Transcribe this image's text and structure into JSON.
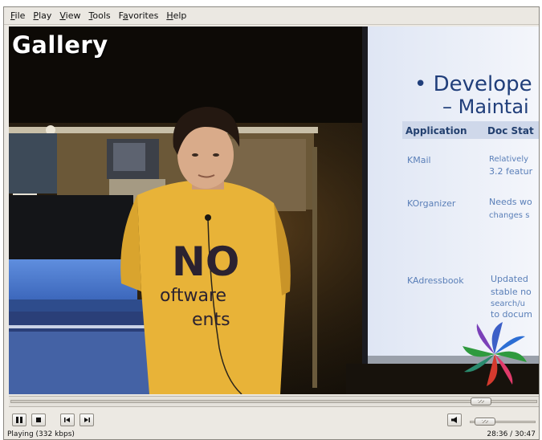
{
  "menu": [
    {
      "label": "File",
      "key": "F",
      "rest": "ile"
    },
    {
      "label": "Play",
      "key": "P",
      "rest": "lay"
    },
    {
      "label": "View",
      "key": "V",
      "rest": "iew"
    },
    {
      "label": "Tools",
      "key": "T",
      "rest": "ools"
    },
    {
      "label": "Favorites",
      "key": "a",
      "pre": "F",
      "rest": "vorites"
    },
    {
      "label": "Help",
      "key": "H",
      "rest": "elp"
    }
  ],
  "video": {
    "overlay_label": "Gallery",
    "shirt_text_line1": "NO",
    "shirt_text_line2": "oftware",
    "shirt_text_line3": "ents",
    "slide": {
      "title_line1": "• Develope",
      "title_line2": "– Maintai",
      "col_app": "Application",
      "col_doc": "Doc Stat",
      "rows": [
        {
          "app": "KMail",
          "doc1": "Relatively",
          "doc2": "3.2 featur"
        },
        {
          "app": "KOrganizer",
          "doc1": "Needs wo",
          "doc2": "changes s"
        },
        {
          "app": "KAdressbook",
          "doc1": "Updated",
          "doc2": "stable no",
          "doc3": "search/u",
          "doc4": "to docum"
        }
      ]
    }
  },
  "playback": {
    "seek_progress": 0.91,
    "volume": 0.1
  },
  "controls": {
    "pause_icon": "pause-icon",
    "stop_icon": "stop-icon",
    "prev_icon": "previous-icon",
    "next_icon": "next-icon",
    "mute_icon": "speaker-icon"
  },
  "status": {
    "left": "Playing (332 kbps)",
    "right": "28:36 / 30:47"
  }
}
